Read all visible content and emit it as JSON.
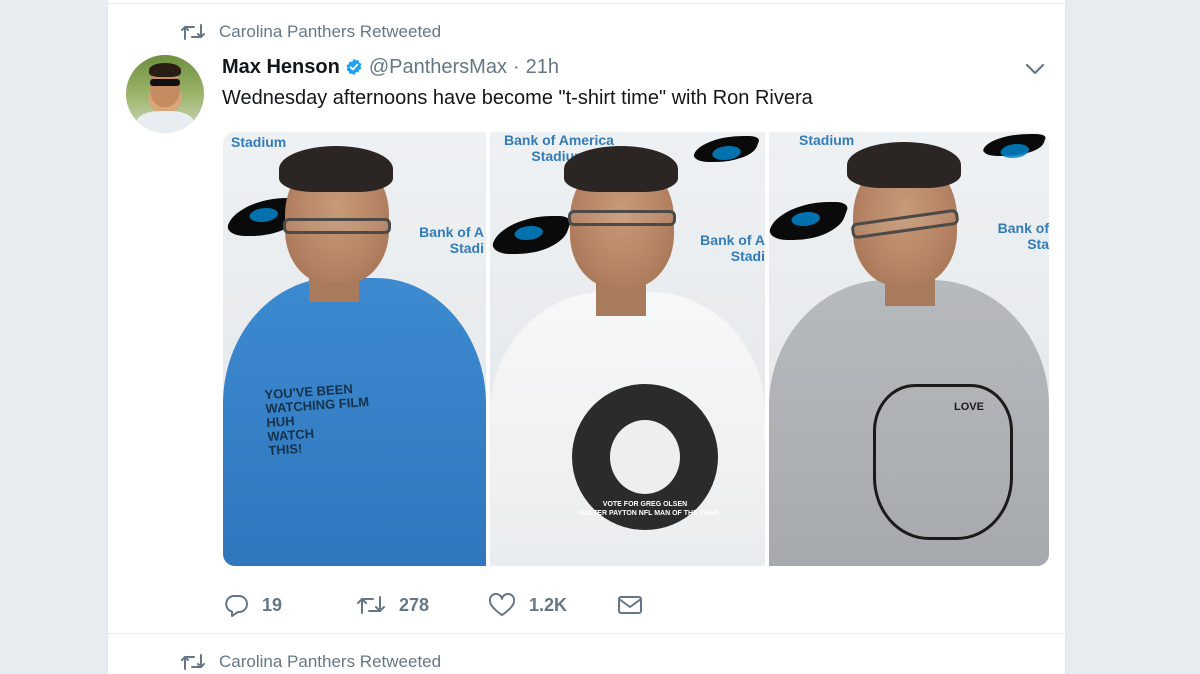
{
  "tweet": {
    "retweet_context": "Carolina Panthers Retweeted",
    "author_name": "Max Henson",
    "handle": "@PanthersMax",
    "separator": "·",
    "time": "21h",
    "verified": true,
    "text": "Wednesday afternoons have become \"t-shirt time\" with Ron Rivera",
    "media_count": 3,
    "stats": {
      "replies": "19",
      "retweets": "278",
      "likes": "1.2K"
    }
  },
  "next_tweet": {
    "retweet_context": "Carolina Panthers Retweeted"
  },
  "colors": {
    "background": "#e6ecf0",
    "card": "#ffffff",
    "text": "#14171a",
    "muted": "#657786",
    "verified": "#1da1f2"
  },
  "icons": {
    "retweet_context": "retweet-icon",
    "verified": "verified-badge-icon",
    "caret": "chevron-down-icon",
    "reply": "reply-icon",
    "retweet": "retweet-icon",
    "like": "heart-icon",
    "dm": "envelope-icon"
  },
  "photos": [
    {
      "wall_text_1": "Stadium",
      "wall_text_2": "Bank of A\nStadi",
      "shirt_text": "YOU'VE BEEN\nWATCHING FILM\nHUH\nWATCH\nTHIS!"
    },
    {
      "wall_text_1": "Bank of America\nStadium",
      "wall_text_2": "Bank of A\nStadi",
      "shirt_text": "VOTE FOR GREG OLSEN\nWALTER PAYTON NFL MAN OF THE YEAR"
    },
    {
      "wall_text_1": "Stadium",
      "wall_text_2": "Bank of\nSta",
      "shirt_text": "LOVE"
    }
  ]
}
